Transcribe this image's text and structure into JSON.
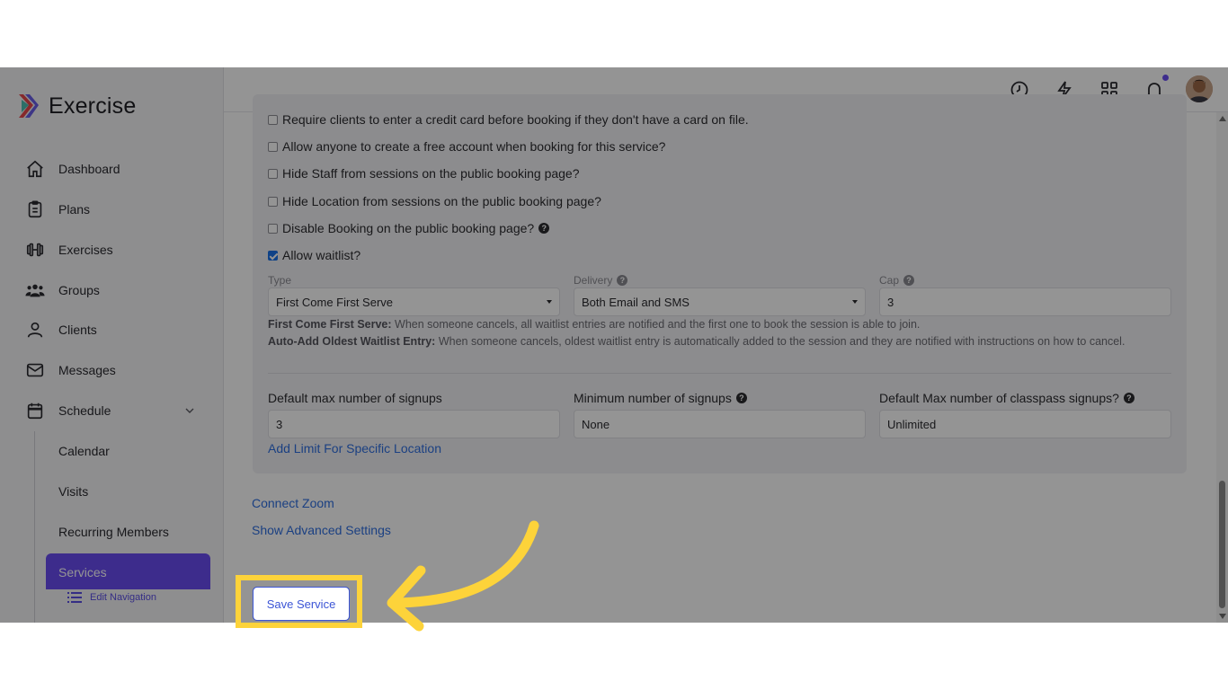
{
  "brand": {
    "name": "Exercise"
  },
  "sidebar": {
    "items": [
      {
        "label": "Dashboard",
        "icon": "home-icon"
      },
      {
        "label": "Plans",
        "icon": "clipboard-icon"
      },
      {
        "label": "Exercises",
        "icon": "dumbbell-icon"
      },
      {
        "label": "Groups",
        "icon": "users-icon"
      },
      {
        "label": "Clients",
        "icon": "user-icon"
      },
      {
        "label": "Messages",
        "icon": "mail-icon"
      },
      {
        "label": "Schedule",
        "icon": "calendar-icon"
      }
    ],
    "schedule_children": [
      "Calendar",
      "Visits",
      "Recurring Members",
      "Services"
    ],
    "active": "Services",
    "edit_navigation": "Edit Navigation"
  },
  "options": [
    {
      "label": "Require clients to enter a credit card before booking if they don't have a card on file.",
      "checked": false,
      "help": false
    },
    {
      "label": "Allow anyone to create a free account when booking for this service?",
      "checked": false,
      "help": false
    },
    {
      "label": "Hide Staff from sessions on the public booking page?",
      "checked": false,
      "help": false
    },
    {
      "label": "Hide Location from sessions on the public booking page?",
      "checked": false,
      "help": false
    },
    {
      "label": "Disable Booking on the public booking page?",
      "checked": false,
      "help": true
    },
    {
      "label": "Allow waitlist?",
      "checked": true,
      "help": false
    }
  ],
  "waitlist": {
    "type_label": "Type",
    "type_value": "First Come First Serve",
    "delivery_label": "Delivery",
    "delivery_value": "Both Email and SMS",
    "cap_label": "Cap",
    "cap_value": "3",
    "desc1_bold": "First Come First Serve:",
    "desc1_text": " When someone cancels, all waitlist entries are notified and the first one to book the session is able to join.",
    "desc2_bold": "Auto-Add Oldest Waitlist Entry:",
    "desc2_text": " When someone cancels, oldest waitlist entry is automatically added to the session and they are notified with instructions on how to cancel."
  },
  "signups": {
    "max_label": "Default max number of signups",
    "max_value": "3",
    "min_label": "Minimum number of signups",
    "min_value": "None",
    "classpass_label": "Default Max number of classpass signups?",
    "classpass_value": "Unlimited",
    "add_limit_link": "Add Limit For Specific Location"
  },
  "links": {
    "connect_zoom": "Connect Zoom",
    "advanced": "Show Advanced Settings"
  },
  "save_button": "Save Service",
  "colors": {
    "accent": "#6a4df2",
    "link": "#2f6fe0",
    "highlight": "#fdd33a",
    "button_border": "#3c55d6"
  }
}
